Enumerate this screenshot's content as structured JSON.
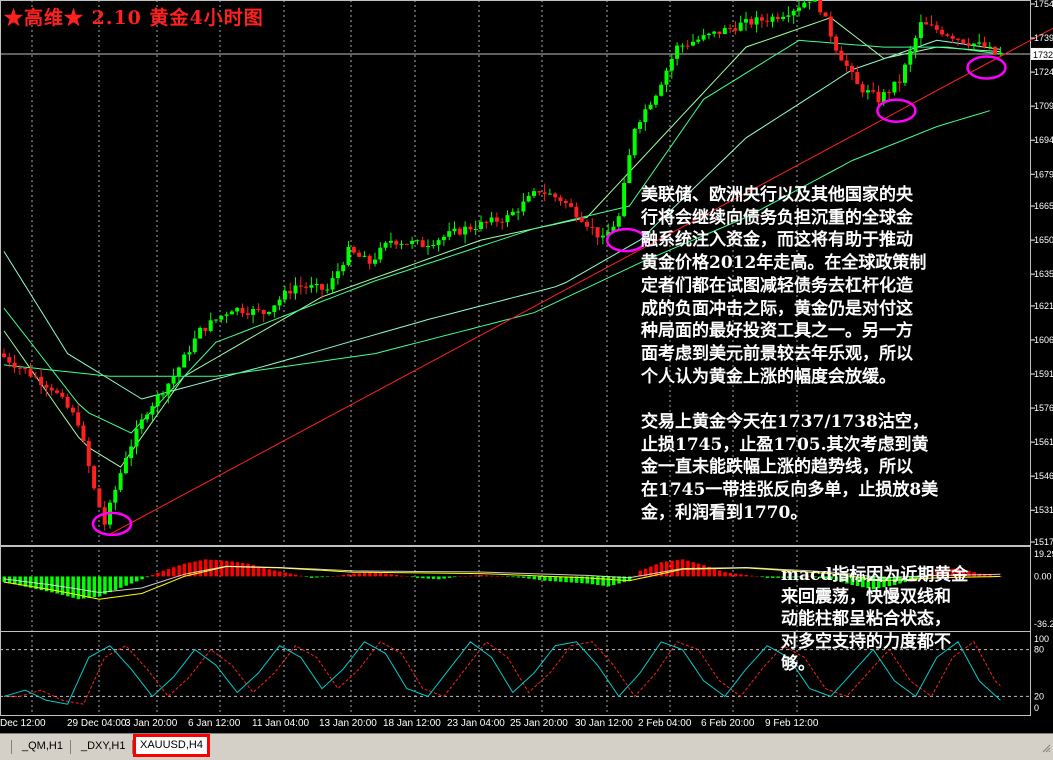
{
  "title": "★高维★ 2.10 黄金4小时图",
  "notes": {
    "main": "美联储、欧洲央行以及其他国家的央\n行将会继续向债务负担沉重的全球金\n融系统注入资金，而这将有助于推动\n黄金价格2012年走高。在全球政策制\n定者们都在试图减轻债务去杠杆化造\n成的负面冲击之际，黄金仍是对付这\n种局面的最好投资工具之一。另一方\n面考虑到美元前景较去年乐观，所以\n个人认为黄金上涨的幅度会放缓。\n\n交易上黄金今天在1737/1738沽空，\n止损1745，止盈1705.其次考虑到黄\n金一直未能跌幅上涨的趋势线，所以\n在1745一带挂张反向多单，止损放8美\n金，利润看到1770。",
    "macd": "macd指标因为近期黄金\n来回震荡，快慢双线和\n动能柱都呈粘合状态，\n对多空支持的力度都不\n够。"
  },
  "tabs": [
    "_QM,H1",
    "_DXY,H1",
    "XAUUSD,H4"
  ],
  "colors": {
    "background": "#000000",
    "up_candle": "#00ff00",
    "down_candle": "#ff2020",
    "trendline": "#ff2020",
    "ellipse": "#ff00ff",
    "macd_pos": "#ff0000",
    "macd_neg": "#00ff00",
    "macd_signal": "#ffff00",
    "stoch_main": "#00cccc",
    "stoch_signal": "#ff2020",
    "ma_fast": "#a0ffa0",
    "ma_mid": "#40ff90",
    "ma_slow": "#90ffd0",
    "grid": "#c0c0c0"
  },
  "chart_data": [
    {
      "type": "candlestick",
      "title": "★高维★ 2.10 黄金4小时图",
      "symbol": "XAUUSD,H4",
      "ylim": [
        1517,
        1754
      ],
      "y_ticks": [
        1754,
        1739,
        1724,
        1709,
        1694,
        1679,
        1665,
        1650,
        1635,
        1621,
        1606,
        1591,
        1576,
        1561,
        1546,
        1531,
        1517
      ],
      "current_price": 1732,
      "x_ticks": [
        "Dec 12:00",
        "29 Dec 04:00",
        "3 Jan 20:00",
        "6 Jan 12:00",
        "11 Jan 04:00",
        "13 Jan 20:00",
        "18 Jan 12:00",
        "23 Jan 04:00",
        "25 Jan 20:00",
        "30 Jan 12:00",
        "2 Feb 04:00",
        "6 Feb 20:00",
        "9 Feb 12:00"
      ],
      "price_path": [
        [
          0,
          1600
        ],
        [
          10,
          1585
        ],
        [
          15,
          1570
        ],
        [
          18,
          1540
        ],
        [
          20,
          1525
        ],
        [
          24,
          1555
        ],
        [
          28,
          1575
        ],
        [
          33,
          1590
        ],
        [
          38,
          1610
        ],
        [
          44,
          1620
        ],
        [
          50,
          1618
        ],
        [
          56,
          1630
        ],
        [
          62,
          1628
        ],
        [
          66,
          1645
        ],
        [
          70,
          1640
        ],
        [
          74,
          1650
        ],
        [
          80,
          1648
        ],
        [
          88,
          1655
        ],
        [
          96,
          1660
        ],
        [
          102,
          1672
        ],
        [
          106,
          1668
        ],
        [
          110,
          1660
        ],
        [
          114,
          1650
        ],
        [
          117,
          1660
        ],
        [
          120,
          1700
        ],
        [
          124,
          1715
        ],
        [
          128,
          1735
        ],
        [
          134,
          1740
        ],
        [
          140,
          1745
        ],
        [
          146,
          1748
        ],
        [
          150,
          1752
        ],
        [
          154,
          1758
        ],
        [
          158,
          1735
        ],
        [
          162,
          1718
        ],
        [
          166,
          1712
        ],
        [
          170,
          1720
        ],
        [
          174,
          1745
        ],
        [
          178,
          1742
        ],
        [
          182,
          1738
        ],
        [
          186,
          1735
        ],
        [
          188,
          1732
        ]
      ],
      "moving_averages": [
        {
          "name": "",
          "color": "#a0ffa0",
          "path": [
            [
              0,
              1610
            ],
            [
              15,
              1560
            ],
            [
              22,
              1550
            ],
            [
              34,
              1590
            ],
            [
              60,
              1625
            ],
            [
              90,
              1650
            ],
            [
              110,
              1660
            ],
            [
              124,
              1695
            ],
            [
              140,
              1735
            ],
            [
              156,
              1748
            ],
            [
              166,
              1730
            ],
            [
              176,
              1735
            ],
            [
              188,
              1733
            ]
          ]
        },
        {
          "name": "",
          "color": "#40ff90",
          "path": [
            [
              0,
              1620
            ],
            [
              15,
              1575
            ],
            [
              24,
              1565
            ],
            [
              40,
              1605
            ],
            [
              70,
              1632
            ],
            [
              100,
              1655
            ],
            [
              118,
              1665
            ],
            [
              132,
              1712
            ],
            [
              150,
              1738
            ],
            [
              166,
              1735
            ],
            [
              178,
              1735
            ],
            [
              188,
              1732
            ]
          ]
        },
        {
          "name": "",
          "color": "#90ffd0",
          "path": [
            [
              0,
              1645
            ],
            [
              12,
              1600
            ],
            [
              26,
              1580
            ],
            [
              50,
              1595
            ],
            [
              80,
              1615
            ],
            [
              105,
              1630
            ],
            [
              120,
              1650
            ],
            [
              140,
              1695
            ],
            [
              160,
              1725
            ],
            [
              176,
              1738
            ],
            [
              188,
              1734
            ]
          ]
        },
        {
          "name": "",
          "color": "#40ff90",
          "path": [
            [
              0,
              1595
            ],
            [
              20,
              1590
            ],
            [
              40,
              1590
            ],
            [
              70,
              1600
            ],
            [
              100,
              1618
            ],
            [
              120,
              1640
            ],
            [
              140,
              1660
            ],
            [
              160,
              1685
            ],
            [
              176,
              1700
            ],
            [
              186,
              1707
            ]
          ]
        }
      ],
      "trendline": {
        "from": [
          20,
          1520
        ],
        "to": [
          210,
          1758
        ]
      },
      "ellipses": [
        [
          20,
          1525
        ],
        [
          117,
          1650
        ],
        [
          168,
          1707
        ],
        [
          185,
          1726
        ]
      ]
    },
    {
      "type": "bar",
      "title": "MACD",
      "ylim": [
        -36.25,
        19.29
      ],
      "y_ticks": [
        19.29,
        0.0,
        -36.25
      ],
      "histogram_path": [
        [
          0,
          -4
        ],
        [
          5,
          -8
        ],
        [
          10,
          -12
        ],
        [
          14,
          -16
        ],
        [
          18,
          -14
        ],
        [
          22,
          -8
        ],
        [
          26,
          -2
        ],
        [
          30,
          4
        ],
        [
          34,
          9
        ],
        [
          38,
          12
        ],
        [
          42,
          11
        ],
        [
          46,
          9
        ],
        [
          50,
          5
        ],
        [
          54,
          2
        ],
        [
          58,
          -1
        ],
        [
          62,
          0
        ],
        [
          66,
          2
        ],
        [
          70,
          3
        ],
        [
          74,
          1
        ],
        [
          78,
          -1
        ],
        [
          82,
          -2
        ],
        [
          86,
          0
        ],
        [
          90,
          1
        ],
        [
          94,
          0
        ],
        [
          98,
          -1
        ],
        [
          102,
          -3
        ],
        [
          106,
          -4
        ],
        [
          110,
          -5
        ],
        [
          114,
          -7
        ],
        [
          118,
          -3
        ],
        [
          120,
          4
        ],
        [
          124,
          10
        ],
        [
          128,
          12
        ],
        [
          132,
          8
        ],
        [
          136,
          3
        ],
        [
          140,
          1
        ],
        [
          144,
          -1
        ],
        [
          148,
          -1
        ],
        [
          152,
          0
        ],
        [
          156,
          -2
        ],
        [
          160,
          -6
        ],
        [
          164,
          -9
        ],
        [
          168,
          -6
        ],
        [
          172,
          -2
        ],
        [
          176,
          4
        ],
        [
          180,
          6
        ],
        [
          184,
          2
        ],
        [
          188,
          0
        ]
      ],
      "signal_path": [
        [
          0,
          -4
        ],
        [
          10,
          -10
        ],
        [
          18,
          -16
        ],
        [
          26,
          -12
        ],
        [
          34,
          0
        ],
        [
          42,
          7
        ],
        [
          52,
          6
        ],
        [
          66,
          3
        ],
        [
          90,
          2
        ],
        [
          110,
          -1
        ],
        [
          118,
          -3
        ],
        [
          128,
          5
        ],
        [
          140,
          6
        ],
        [
          156,
          2
        ],
        [
          166,
          -3
        ],
        [
          176,
          -1
        ],
        [
          188,
          0
        ]
      ]
    },
    {
      "type": "line",
      "title": "Stochastic",
      "ylim": [
        0,
        100
      ],
      "y_ticks": [
        100,
        80,
        20,
        0
      ],
      "levels": [
        80,
        20
      ],
      "main": [
        [
          0,
          20
        ],
        [
          4,
          28
        ],
        [
          8,
          15
        ],
        [
          12,
          10
        ],
        [
          16,
          70
        ],
        [
          20,
          85
        ],
        [
          24,
          55
        ],
        [
          28,
          20
        ],
        [
          32,
          45
        ],
        [
          36,
          80
        ],
        [
          40,
          60
        ],
        [
          44,
          25
        ],
        [
          48,
          50
        ],
        [
          52,
          85
        ],
        [
          56,
          70
        ],
        [
          60,
          30
        ],
        [
          64,
          55
        ],
        [
          68,
          90
        ],
        [
          72,
          75
        ],
        [
          76,
          30
        ],
        [
          80,
          20
        ],
        [
          84,
          55
        ],
        [
          88,
          90
        ],
        [
          92,
          70
        ],
        [
          96,
          25
        ],
        [
          100,
          50
        ],
        [
          104,
          85
        ],
        [
          108,
          90
        ],
        [
          112,
          60
        ],
        [
          116,
          20
        ],
        [
          120,
          50
        ],
        [
          124,
          90
        ],
        [
          128,
          80
        ],
        [
          132,
          40
        ],
        [
          136,
          20
        ],
        [
          140,
          55
        ],
        [
          144,
          85
        ],
        [
          148,
          70
        ],
        [
          152,
          30
        ],
        [
          156,
          20
        ],
        [
          160,
          50
        ],
        [
          164,
          80
        ],
        [
          168,
          40
        ],
        [
          172,
          20
        ],
        [
          176,
          70
        ],
        [
          180,
          90
        ],
        [
          184,
          40
        ],
        [
          188,
          15
        ]
      ]
    }
  ]
}
